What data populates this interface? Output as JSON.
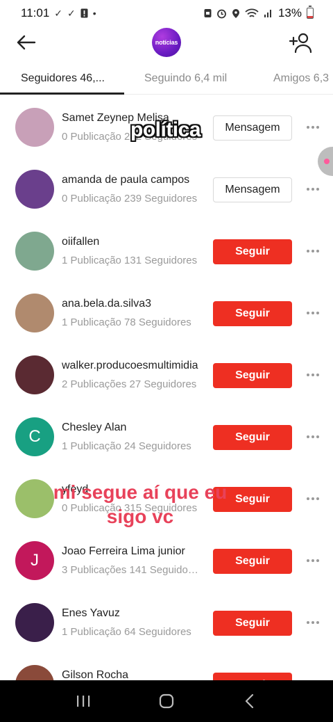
{
  "status_bar": {
    "time": "11:01",
    "battery": "13%"
  },
  "header": {
    "logo_text": "notícias"
  },
  "tabs": [
    {
      "label": "Seguidores 46,..."
    },
    {
      "label": "Seguindo 6,4 mil"
    },
    {
      "label": "Amigos 6,3"
    }
  ],
  "users": [
    {
      "name": "Samet Zeynep Melisa",
      "stats": "0 Publicação 282 Seguidores",
      "button": "Mensagem",
      "button_type": "message",
      "avatar_color": "#c8a0b8"
    },
    {
      "name": "amanda de paula campos",
      "stats": "0 Publicação 239 Seguidores",
      "button": "Mensagem",
      "button_type": "message",
      "avatar_color": "#6a3f8c"
    },
    {
      "name": "oiifallen",
      "stats": "1 Publicação 131 Seguidores",
      "button": "Seguir",
      "button_type": "follow",
      "avatar_color": "#7fa88f"
    },
    {
      "name": "ana.bela.da.silva3",
      "stats": "1 Publicação 78 Seguidores",
      "button": "Seguir",
      "button_type": "follow",
      "avatar_color": "#b08a6e"
    },
    {
      "name": "walker.producoesmultimidia",
      "stats": "2 Publicações 27 Seguidores",
      "button": "Seguir",
      "button_type": "follow",
      "avatar_color": "#5a2a32"
    },
    {
      "name": "Chesley Alan",
      "stats": "1 Publicação 24 Seguidores",
      "button": "Seguir",
      "button_type": "follow",
      "avatar_color": "#18a082",
      "avatar_letter": "C"
    },
    {
      "name": "yfeyd",
      "stats": "0 Publicação 315 Seguidores",
      "button": "Seguir",
      "button_type": "follow",
      "avatar_color": "#9bbf6a"
    },
    {
      "name": "Joao Ferreira Lima junior",
      "stats": "3 Publicações 141 Seguidores",
      "button": "Seguir",
      "button_type": "follow",
      "avatar_color": "#c2185b",
      "avatar_letter": "J"
    },
    {
      "name": "Enes  Yavuz",
      "stats": "1 Publicação 64 Seguidores",
      "button": "Seguir",
      "button_type": "follow",
      "avatar_color": "#3a1f4a"
    },
    {
      "name": "Gilson Rocha",
      "stats": "",
      "button": "Seguir",
      "button_type": "follow",
      "avatar_color": "#8a4a3a"
    }
  ],
  "captions": {
    "politica": "política",
    "segue": "mi segue aí que eu sigo vc"
  },
  "colors": {
    "follow_button": "#ee2f22",
    "logo": "#7a22d0",
    "caption_pink": "#e8425a"
  }
}
